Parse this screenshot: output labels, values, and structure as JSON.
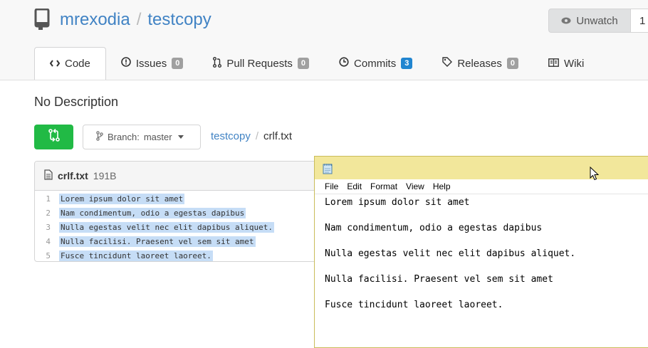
{
  "repo": {
    "owner": "mrexodia",
    "separator": "/",
    "name": "testcopy"
  },
  "watch": {
    "label": "Unwatch",
    "count": "1"
  },
  "tabs": [
    {
      "label": "Code",
      "icon": "code-icon",
      "active": true
    },
    {
      "label": "Issues",
      "icon": "issue-icon",
      "badge": "0"
    },
    {
      "label": "Pull Requests",
      "icon": "pull-request-icon",
      "badge": "0"
    },
    {
      "label": "Commits",
      "icon": "history-icon",
      "badge": "3",
      "badge_color": "#2185d0"
    },
    {
      "label": "Releases",
      "icon": "tag-icon",
      "badge": "0"
    },
    {
      "label": "Wiki",
      "icon": "book-icon"
    }
  ],
  "description": "No Description",
  "branch": {
    "prefix": "Branch:",
    "value": "master"
  },
  "breadcrumb": {
    "repo": "testcopy",
    "separator": "/",
    "file": "crlf.txt"
  },
  "file": {
    "name": "crlf.txt",
    "size": "191B",
    "lines": [
      {
        "num": "1",
        "text": "Lorem ipsum dolor sit amet"
      },
      {
        "num": "2",
        "text": "Nam condimentum, odio a egestas dapibus"
      },
      {
        "num": "3",
        "text": "Nulla egestas velit nec elit dapibus aliquet."
      },
      {
        "num": "4",
        "text": "Nulla facilisi. Praesent vel sem sit amet"
      },
      {
        "num": "5",
        "text": "Fusce tincidunt laoreet laoreet."
      }
    ]
  },
  "notepad": {
    "menu": [
      "File",
      "Edit",
      "Format",
      "View",
      "Help"
    ],
    "lines": [
      "Lorem ipsum dolor sit amet",
      "Nam condimentum, odio a egestas dapibus",
      "Nulla egestas velit nec elit dapibus aliquet.",
      "Nulla facilisi. Praesent vel sem sit amet",
      "Fusce tincidunt laoreet laoreet."
    ]
  },
  "colors": {
    "link": "#4183c4",
    "green_button": "#21ba45",
    "selection": "#c6ddf6",
    "notepad_title": "#f2e79b"
  }
}
